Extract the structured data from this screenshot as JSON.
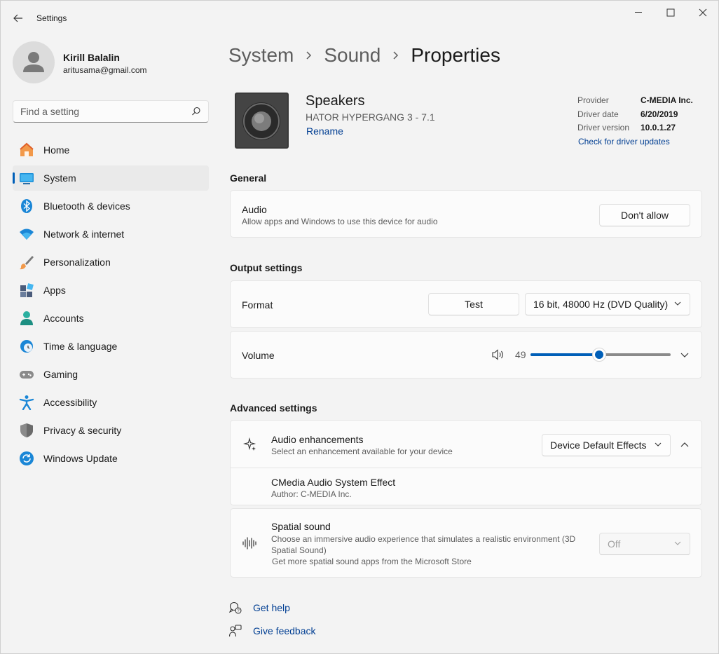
{
  "window": {
    "title": "Settings"
  },
  "user": {
    "name": "Kirill Balalin",
    "email": "aritusama@gmail.com"
  },
  "search": {
    "placeholder": "Find a setting"
  },
  "nav": {
    "items": [
      {
        "label": "Home",
        "icon": "home-icon"
      },
      {
        "label": "System",
        "icon": "system-icon",
        "active": true
      },
      {
        "label": "Bluetooth & devices",
        "icon": "bluetooth-icon"
      },
      {
        "label": "Network & internet",
        "icon": "wifi-icon"
      },
      {
        "label": "Personalization",
        "icon": "brush-icon"
      },
      {
        "label": "Apps",
        "icon": "apps-icon"
      },
      {
        "label": "Accounts",
        "icon": "accounts-icon"
      },
      {
        "label": "Time & language",
        "icon": "clock-globe-icon"
      },
      {
        "label": "Gaming",
        "icon": "gamepad-icon"
      },
      {
        "label": "Accessibility",
        "icon": "accessibility-icon"
      },
      {
        "label": "Privacy & security",
        "icon": "shield-icon"
      },
      {
        "label": "Windows Update",
        "icon": "update-icon"
      }
    ]
  },
  "breadcrumb": {
    "items": [
      "System",
      "Sound"
    ],
    "current": "Properties"
  },
  "device": {
    "name": "Speakers",
    "model": "HATOR HYPERGANG 3 - 7.1",
    "rename_label": "Rename",
    "driver": {
      "provider_label": "Provider",
      "provider": "C-MEDIA Inc.",
      "date_label": "Driver date",
      "date": "6/20/2019",
      "version_label": "Driver version",
      "version": "10.0.1.27",
      "update_link": "Check for driver updates"
    }
  },
  "general": {
    "title": "General",
    "audio": {
      "title": "Audio",
      "subtitle": "Allow apps and Windows to use this device for audio",
      "button": "Don't allow"
    }
  },
  "output": {
    "title": "Output settings",
    "format": {
      "title": "Format",
      "test_button": "Test",
      "selected": "16 bit, 48000 Hz (DVD Quality)"
    },
    "volume": {
      "title": "Volume",
      "value": "49",
      "level": 0.49
    }
  },
  "advanced": {
    "title": "Advanced settings",
    "enhancements": {
      "title": "Audio enhancements",
      "subtitle": "Select an enhancement available for your device",
      "selected": "Device Default Effects"
    },
    "effect": {
      "title": "CMedia Audio System Effect",
      "author": "Author: C-MEDIA Inc."
    },
    "spatial": {
      "title": "Spatial sound",
      "subtitle_line1": "Choose an immersive audio experience that simulates a realistic environment (3D",
      "subtitle_line2": "Spatial Sound)",
      "store_link": "Get more spatial sound apps from the Microsoft Store",
      "selected": "Off"
    }
  },
  "footer": {
    "help": "Get help",
    "feedback": "Give feedback"
  },
  "colors": {
    "accent": "#005fb8",
    "link": "#003e92",
    "background": "#f3f3f3",
    "card": "#fbfbfb"
  }
}
